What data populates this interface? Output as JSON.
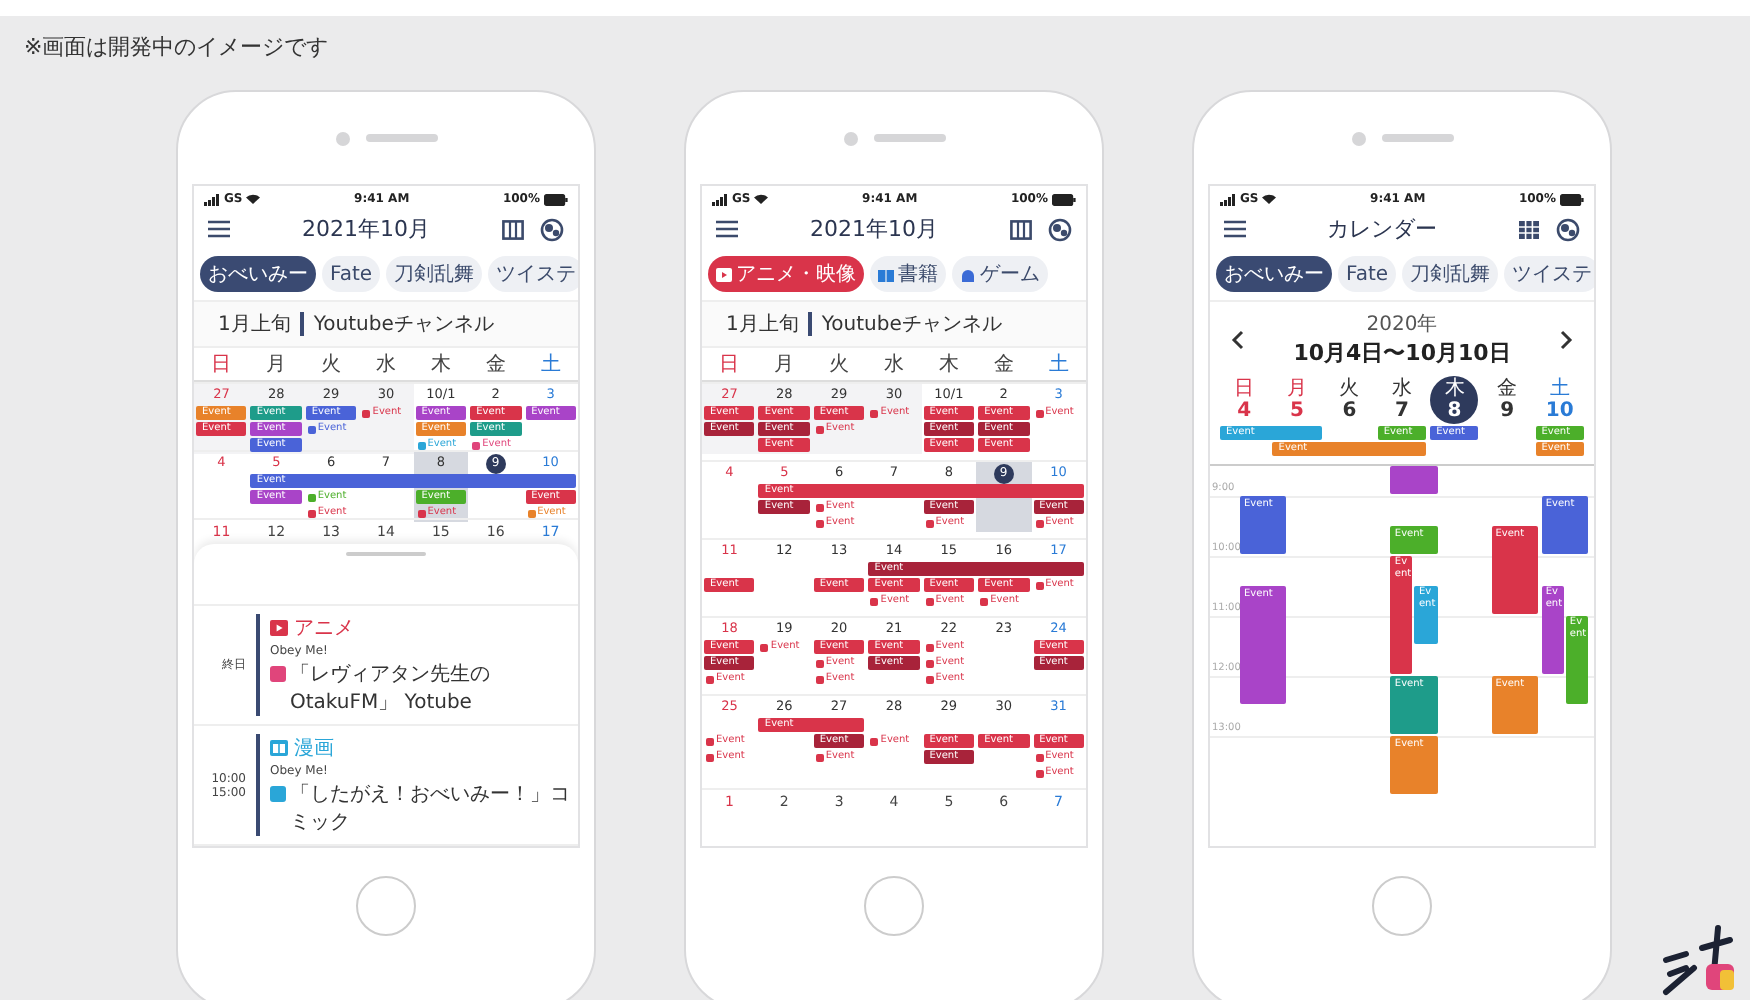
{
  "caption": "※画面は開発中のイメージです",
  "phones": [
    {
      "kind": "month",
      "status": {
        "carrier": "GS",
        "time": "9:41 AM",
        "battery": "100%"
      },
      "title": "2021年10月",
      "chips": [
        {
          "label": "おべいみー",
          "selected": true
        },
        {
          "label": "Fate",
          "selected": false
        },
        {
          "label": "刀剣乱舞",
          "selected": false
        },
        {
          "label": "ツイステ",
          "selected": false
        }
      ],
      "banner": {
        "period": "1月上旬",
        "title": "Youtubeチャンネル"
      },
      "weekdays": [
        "日",
        "月",
        "火",
        "水",
        "木",
        "金",
        "土"
      ],
      "weeks": [
        {
          "days": [
            {
              "date": "27",
              "other_month": true,
              "events": [
                {
                  "label": "Event",
                  "kind": "filled",
                  "color": "#e8822a"
                },
                {
                  "label": "Event",
                  "kind": "filled",
                  "color": "#d9344a"
                }
              ]
            },
            {
              "date": "28",
              "other_month": true,
              "events": [
                {
                  "label": "Event",
                  "kind": "filled",
                  "color": "#1e9c8a"
                },
                {
                  "label": "Event",
                  "kind": "filled",
                  "color": "#a944c8"
                },
                {
                  "label": "Event",
                  "kind": "filled",
                  "color": "#4a63d8"
                }
              ]
            },
            {
              "date": "29",
              "other_month": true,
              "events": [
                {
                  "label": "Event",
                  "kind": "filled",
                  "color": "#4a63d8"
                },
                {
                  "label": "Event",
                  "kind": "text",
                  "color": "#4a63d8"
                }
              ]
            },
            {
              "date": "30",
              "other_month": true,
              "events": [
                {
                  "label": "Event",
                  "kind": "text",
                  "color": "#d9344a"
                }
              ]
            },
            {
              "date": "10/1",
              "events": [
                {
                  "label": "Event",
                  "kind": "filled",
                  "color": "#a944c8"
                },
                {
                  "label": "Event",
                  "kind": "filled",
                  "color": "#e8822a"
                },
                {
                  "label": "Event",
                  "kind": "text",
                  "color": "#2aa6d8"
                }
              ]
            },
            {
              "date": "2",
              "events": [
                {
                  "label": "Event",
                  "kind": "filled",
                  "color": "#d9344a"
                },
                {
                  "label": "Event",
                  "kind": "filled",
                  "color": "#1e9c8a"
                },
                {
                  "label": "Event",
                  "kind": "text",
                  "color": "#e0457b"
                }
              ]
            },
            {
              "date": "3",
              "events": [
                {
                  "label": "Event",
                  "kind": "filled",
                  "color": "#a944c8"
                }
              ]
            }
          ]
        },
        {
          "bars": [
            {
              "label": "Event",
              "color": "#4a63d8"
            }
          ],
          "days": [
            {
              "date": "4"
            },
            {
              "date": "5",
              "holiday": true,
              "events": [
                {
                  "label": "Event",
                  "kind": "filled",
                  "color": "#a944c8"
                }
              ]
            },
            {
              "date": "6",
              "events": [
                {
                  "label": "Event",
                  "kind": "text",
                  "color": "#4caf2a"
                },
                {
                  "label": "Event",
                  "kind": "text",
                  "color": "#d9344a"
                }
              ]
            },
            {
              "date": "7"
            },
            {
              "date": "8",
              "selected": true,
              "events": [
                {
                  "label": "Event",
                  "kind": "filled",
                  "color": "#4caf2a"
                },
                {
                  "label": "Event",
                  "kind": "text",
                  "color": "#d9344a"
                }
              ]
            },
            {
              "date": "9",
              "today": true
            },
            {
              "date": "10",
              "events": [
                {
                  "label": "Event",
                  "kind": "filled",
                  "color": "#d9344a"
                },
                {
                  "label": "Event",
                  "kind": "text",
                  "color": "#e8822a"
                }
              ]
            }
          ]
        }
      ],
      "trailing_dates": [
        "11",
        "12",
        "13",
        "14",
        "15",
        "16",
        "17"
      ],
      "agenda": [
        {
          "kind": "anime",
          "times": [
            "終日"
          ],
          "category": "アニメ",
          "color": "#d9344a",
          "title": "Obey Me!",
          "detail": {
            "text": "「レヴィアタン先生のOtakuFM」 Yotube",
            "color": "#e0457b"
          }
        },
        {
          "kind": "manga",
          "times": [
            "10:00",
            "15:00"
          ],
          "category": "漫画",
          "color": "#2aa6d8",
          "title": "Obey Me!",
          "detail": {
            "text": "「したがえ！おべいみー！」コミック",
            "color": "#2aa6d8"
          }
        }
      ]
    },
    {
      "kind": "month",
      "status": {
        "carrier": "GS",
        "time": "9:41 AM",
        "battery": "100%"
      },
      "title": "2021年10月",
      "chips": [
        {
          "label": "アニメ・映像",
          "kind": "video",
          "selected": true
        },
        {
          "label": "書籍",
          "kind": "book",
          "selected": false
        },
        {
          "label": "ゲーム",
          "kind": "game",
          "selected": false
        }
      ],
      "banner": {
        "period": "1月上旬",
        "title": "Youtubeチャンネル"
      },
      "weekdays": [
        "日",
        "月",
        "火",
        "水",
        "木",
        "金",
        "土"
      ],
      "weeks": [
        {
          "days": [
            {
              "date": "27",
              "other_month": true,
              "events": [
                {
                  "label": "Event",
                  "kind": "filled",
                  "color": "#d9344a"
                },
                {
                  "label": "Event",
                  "kind": "filled",
                  "color": "#a8233a"
                }
              ]
            },
            {
              "date": "28",
              "other_month": true,
              "events": [
                {
                  "label": "Event",
                  "kind": "filled",
                  "color": "#d9344a"
                },
                {
                  "label": "Event",
                  "kind": "filled",
                  "color": "#a8233a"
                },
                {
                  "label": "Event",
                  "kind": "filled",
                  "color": "#d9344a"
                }
              ]
            },
            {
              "date": "29",
              "other_month": true,
              "events": [
                {
                  "label": "Event",
                  "kind": "filled",
                  "color": "#d9344a"
                },
                {
                  "label": "Event",
                  "kind": "text",
                  "color": "#d9344a"
                }
              ]
            },
            {
              "date": "30",
              "other_month": true,
              "events": [
                {
                  "label": "Event",
                  "kind": "text",
                  "color": "#d9344a"
                }
              ]
            },
            {
              "date": "10/1",
              "events": [
                {
                  "label": "Event",
                  "kind": "filled",
                  "color": "#d9344a"
                },
                {
                  "label": "Event",
                  "kind": "filled",
                  "color": "#a8233a"
                },
                {
                  "label": "Event",
                  "kind": "filled",
                  "color": "#d9344a"
                }
              ]
            },
            {
              "date": "2",
              "events": [
                {
                  "label": "Event",
                  "kind": "filled",
                  "color": "#d9344a"
                },
                {
                  "label": "Event",
                  "kind": "filled",
                  "color": "#a8233a"
                },
                {
                  "label": "Event",
                  "kind": "filled",
                  "color": "#d9344a"
                }
              ]
            },
            {
              "date": "3",
              "events": [
                {
                  "label": "Event",
                  "kind": "text",
                  "color": "#d9344a"
                }
              ]
            }
          ]
        },
        {
          "bars": [
            {
              "label": "Event",
              "color": "#d9344a"
            }
          ],
          "days": [
            {
              "date": "4"
            },
            {
              "date": "5",
              "holiday": true,
              "events": [
                {
                  "label": "Event",
                  "kind": "filled",
                  "color": "#a8233a"
                }
              ]
            },
            {
              "date": "6",
              "events": [
                {
                  "label": "Event",
                  "kind": "text",
                  "color": "#d9344a"
                },
                {
                  "label": "Event",
                  "kind": "text",
                  "color": "#d9344a"
                }
              ]
            },
            {
              "date": "7"
            },
            {
              "date": "8",
              "events": [
                {
                  "label": "Event",
                  "kind": "filled",
                  "color": "#a8233a"
                },
                {
                  "label": "Event",
                  "kind": "text",
                  "color": "#d9344a"
                }
              ]
            },
            {
              "date": "9",
              "today": true,
              "selected": true
            },
            {
              "date": "10",
              "events": [
                {
                  "label": "Event",
                  "kind": "filled",
                  "color": "#a8233a"
                },
                {
                  "label": "Event",
                  "kind": "text",
                  "color": "#d9344a"
                }
              ]
            }
          ]
        },
        {
          "bars": [
            {
              "label": "Event",
              "color": "#a8233a"
            }
          ],
          "days": [
            {
              "date": "11",
              "events": [
                {
                  "label": "Event",
                  "kind": "filled",
                  "color": "#d9344a"
                }
              ]
            },
            {
              "date": "12"
            },
            {
              "date": "13",
              "events": [
                {
                  "label": "Event",
                  "kind": "filled",
                  "color": "#d9344a"
                }
              ]
            },
            {
              "date": "14",
              "events": [
                {
                  "label": "Event",
                  "kind": "filled",
                  "color": "#d9344a"
                },
                {
                  "label": "Event",
                  "kind": "text",
                  "color": "#d9344a"
                }
              ]
            },
            {
              "date": "15",
              "events": [
                {
                  "label": "Event",
                  "kind": "filled",
                  "color": "#d9344a"
                },
                {
                  "label": "Event",
                  "kind": "text",
                  "color": "#d9344a"
                }
              ]
            },
            {
              "date": "16",
              "events": [
                {
                  "label": "Event",
                  "kind": "filled",
                  "color": "#d9344a"
                },
                {
                  "label": "Event",
                  "kind": "text",
                  "color": "#d9344a"
                }
              ]
            },
            {
              "date": "17",
              "events": [
                {
                  "label": "Event",
                  "kind": "text",
                  "color": "#d9344a"
                }
              ]
            }
          ]
        },
        {
          "days": [
            {
              "date": "18",
              "events": [
                {
                  "label": "Event",
                  "kind": "filled",
                  "color": "#d9344a"
                },
                {
                  "label": "Event",
                  "kind": "filled",
                  "color": "#a8233a"
                },
                {
                  "label": "Event",
                  "kind": "text",
                  "color": "#d9344a"
                }
              ]
            },
            {
              "date": "19",
              "events": [
                {
                  "label": "Event",
                  "kind": "text",
                  "color": "#d9344a"
                }
              ]
            },
            {
              "date": "20",
              "events": [
                {
                  "label": "Event",
                  "kind": "filled",
                  "color": "#d9344a"
                },
                {
                  "label": "Event",
                  "kind": "text",
                  "color": "#d9344a"
                },
                {
                  "label": "Event",
                  "kind": "text",
                  "color": "#d9344a"
                }
              ]
            },
            {
              "date": "21",
              "events": [
                {
                  "label": "Event",
                  "kind": "filled",
                  "color": "#d9344a"
                },
                {
                  "label": "Event",
                  "kind": "filled",
                  "color": "#a8233a"
                }
              ]
            },
            {
              "date": "22",
              "events": [
                {
                  "label": "Event",
                  "kind": "text",
                  "color": "#d9344a"
                },
                {
                  "label": "Event",
                  "kind": "text",
                  "color": "#d9344a"
                },
                {
                  "label": "Event",
                  "kind": "text",
                  "color": "#d9344a"
                }
              ]
            },
            {
              "date": "23"
            },
            {
              "date": "24",
              "events": [
                {
                  "label": "Event",
                  "kind": "filled",
                  "color": "#d9344a"
                },
                {
                  "label": "Event",
                  "kind": "filled",
                  "color": "#a8233a"
                }
              ]
            }
          ]
        },
        {
          "bars": [
            {
              "label": "Event",
              "color": "#d9344a"
            }
          ],
          "days": [
            {
              "date": "25",
              "events": [
                {
                  "label": "Event",
                  "kind": "text",
                  "color": "#d9344a"
                },
                {
                  "label": "Event",
                  "kind": "text",
                  "color": "#d9344a"
                }
              ]
            },
            {
              "date": "26"
            },
            {
              "date": "27",
              "events": [
                {
                  "label": "Event",
                  "kind": "filled",
                  "color": "#a8233a"
                },
                {
                  "label": "Event",
                  "kind": "text",
                  "color": "#d9344a"
                }
              ]
            },
            {
              "date": "28",
              "events": [
                {
                  "label": "Event",
                  "kind": "text",
                  "color": "#d9344a"
                }
              ]
            },
            {
              "date": "29",
              "events": [
                {
                  "label": "Event",
                  "kind": "filled",
                  "color": "#d9344a"
                },
                {
                  "label": "Event",
                  "kind": "filled",
                  "color": "#a8233a"
                }
              ]
            },
            {
              "date": "30",
              "events": [
                {
                  "label": "Event",
                  "kind": "filled",
                  "color": "#d9344a"
                }
              ]
            },
            {
              "date": "31",
              "events": [
                {
                  "label": "Event",
                  "kind": "filled",
                  "color": "#d9344a"
                },
                {
                  "label": "Event",
                  "kind": "text",
                  "color": "#d9344a"
                },
                {
                  "label": "Event",
                  "kind": "text",
                  "color": "#d9344a"
                }
              ]
            }
          ]
        }
      ],
      "trailing_dates": [
        "1",
        "2",
        "3",
        "4",
        "5",
        "6",
        "7"
      ]
    },
    {
      "kind": "week",
      "status": {
        "carrier": "GS",
        "time": "9:41 AM",
        "battery": "100%"
      },
      "title": "カレンダー",
      "chips": [
        {
          "label": "おべいみー",
          "selected": true
        },
        {
          "label": "Fate",
          "selected": false
        },
        {
          "label": "刀剣乱舞",
          "selected": false
        },
        {
          "label": "ツイステ",
          "selected": false
        }
      ],
      "nav": {
        "year": "2020年",
        "range": "10月4日〜10月10日"
      },
      "days": [
        {
          "dow": "日",
          "date": "4",
          "selected": false,
          "events": [
            {
              "label": "Event",
              "color": "#4a63d8",
              "kind": "full"
            },
            {
              "label": "Event",
              "color": "#a944c8",
              "kind": "full"
            }
          ]
        },
        {
          "dow": "月",
          "date": "5",
          "holiday": true,
          "selected": false
        },
        {
          "dow": "火",
          "date": "6",
          "selected": false
        },
        {
          "dow": "水",
          "date": "7",
          "selected": false,
          "events": [
            {
              "color": "#a944c8",
              "kind": "full"
            },
            {
              "label": "Event",
              "color": "#4caf2a",
              "kind": "full"
            },
            {
              "label": "Event",
              "color": "#d9344a",
              "kind": "left"
            },
            {
              "label": "Event",
              "color": "#2aa6d8",
              "kind": "right"
            },
            {
              "label": "Event",
              "color": "#1e9c8a",
              "kind": "full"
            },
            {
              "label": "Event",
              "color": "#e8822a",
              "kind": "full"
            }
          ]
        },
        {
          "dow": "木",
          "date": "8",
          "selected": true
        },
        {
          "dow": "金",
          "date": "9",
          "selected": false,
          "events": [
            {
              "label": "Event",
              "color": "#d9344a",
              "kind": "full"
            },
            {
              "label": "Event",
              "color": "#e8822a",
              "kind": "full"
            }
          ]
        },
        {
          "dow": "土",
          "date": "10",
          "selected": false,
          "events": [
            {
              "label": "Event",
              "color": "#4a63d8",
              "kind": "full"
            },
            {
              "label": "Event",
              "color": "#a944c8",
              "kind": "left"
            },
            {
              "label": "Event",
              "color": "#4caf2a",
              "kind": "right"
            }
          ]
        }
      ],
      "allday_rows": [
        [
          {
            "label": "Event",
            "color": "#2aa6d8"
          },
          {
            "label": "Event",
            "color": "#4caf2a"
          },
          {
            "label": "Event",
            "color": "#4a63d8"
          },
          {
            "label": "Event",
            "color": "#4caf2a"
          }
        ],
        [
          {
            "label": "Event",
            "color": "#e8822a"
          },
          {
            "label": "Event",
            "color": "#e8822a"
          }
        ]
      ],
      "hours": [
        "9:00",
        "10:00",
        "11:00",
        "12:00",
        "13:00"
      ]
    }
  ]
}
